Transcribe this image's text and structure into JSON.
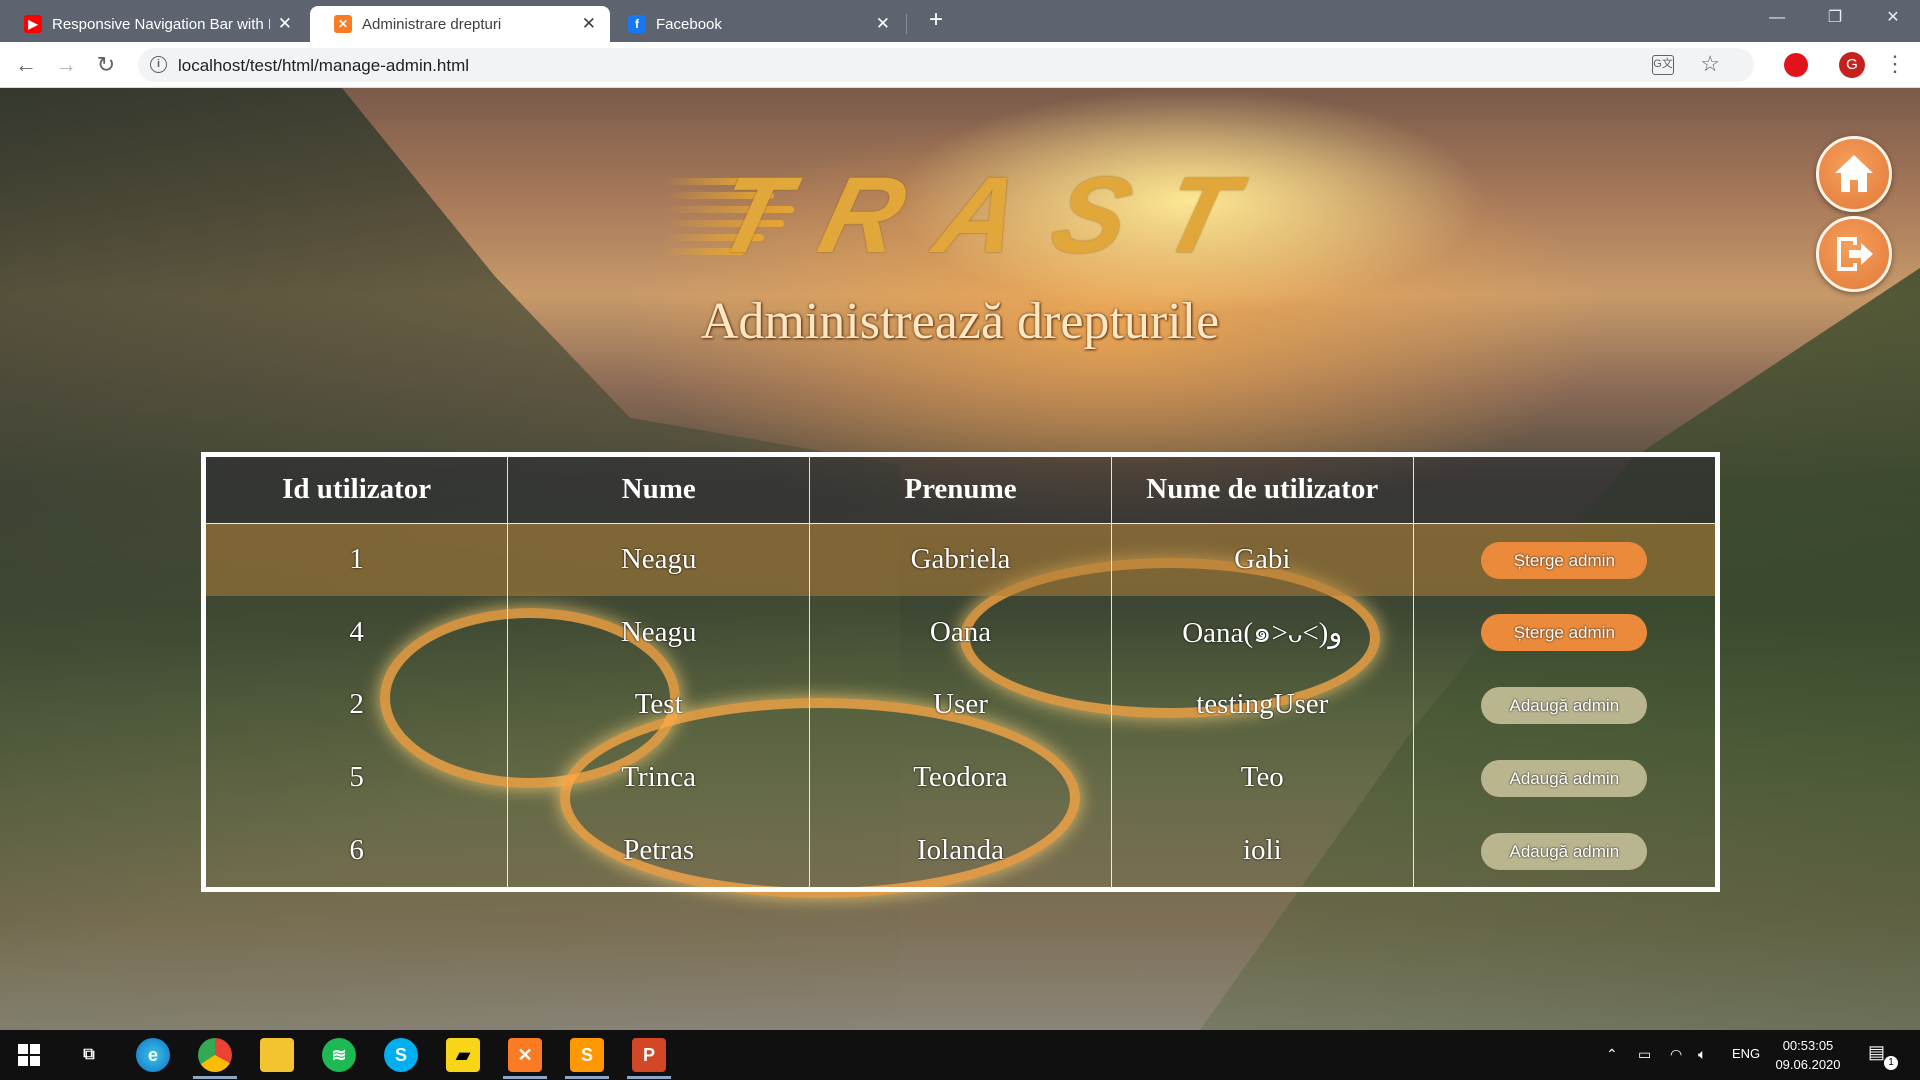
{
  "browser": {
    "tabs": [
      {
        "title": "Responsive Navigation Bar with H",
        "icon": "youtube-icon",
        "active": false
      },
      {
        "title": "Administrare drepturi",
        "icon": "xampp-icon",
        "active": true
      },
      {
        "title": "Facebook",
        "icon": "facebook-icon",
        "active": false
      }
    ],
    "url": "localhost/test/html/manage-admin.html",
    "profile_initial": "G"
  },
  "page": {
    "logo_text": "TRAST",
    "title": "Administrează drepturile",
    "nav": [
      {
        "name": "home-icon"
      },
      {
        "name": "logout-icon"
      }
    ],
    "table": {
      "headers": [
        "Id utilizator",
        "Nume",
        "Prenume",
        "Nume de utilizator",
        ""
      ],
      "rows": [
        {
          "id": "1",
          "nume": "Neagu",
          "prenume": "Gabriela",
          "username": "Gabi",
          "action": "Șterge admin",
          "type": "del"
        },
        {
          "id": "4",
          "nume": "Neagu",
          "prenume": "Oana",
          "username": "Oana(๑>ᴗ<)و",
          "action": "Șterge admin",
          "type": "del"
        },
        {
          "id": "2",
          "nume": "Test",
          "prenume": "User",
          "username": "testingUser",
          "action": "Adaugă admin",
          "type": "add"
        },
        {
          "id": "5",
          "nume": "Trinca",
          "prenume": "Teodora",
          "username": "Teo",
          "action": "Adaugă admin",
          "type": "add"
        },
        {
          "id": "6",
          "nume": "Petras",
          "prenume": "Iolanda",
          "username": "ioli",
          "action": "Adaugă admin",
          "type": "add"
        }
      ]
    },
    "colors": {
      "accent_orange": "#ea8a3a",
      "add_button": "#b9b58f",
      "logo_gold": "#e1a73a"
    }
  },
  "taskbar": {
    "language": "ENG",
    "time": "00:53:05",
    "date": "09.06.2020",
    "notification_count": "1"
  }
}
